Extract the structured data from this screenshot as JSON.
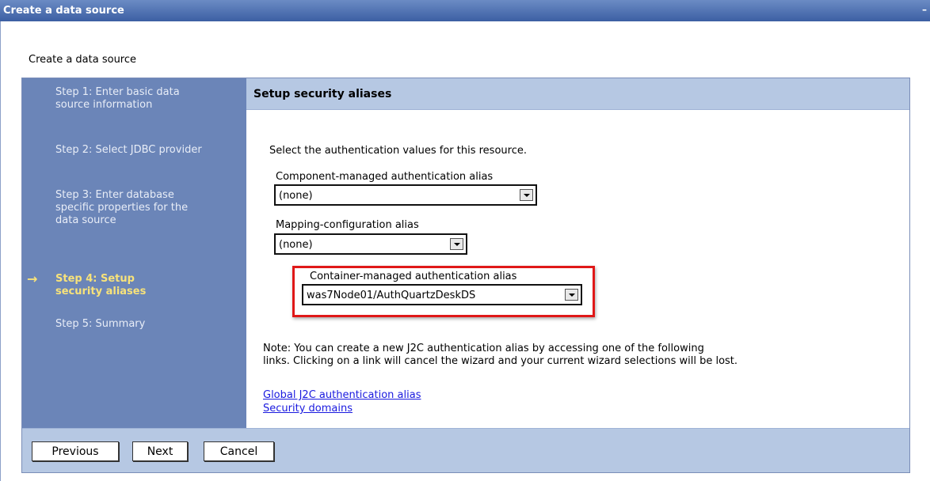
{
  "window": {
    "title": "Create a data source",
    "minimize_glyph": "–"
  },
  "page": {
    "heading": "Create a data source"
  },
  "steps": {
    "items": [
      {
        "label": "Step 1: Enter basic data source information",
        "current": false
      },
      {
        "label": "Step 2: Select JDBC provider",
        "current": false
      },
      {
        "label": "Step 3: Enter database specific properties for the data source",
        "current": false
      },
      {
        "label": "Step 4: Setup security aliases",
        "current": true
      },
      {
        "label": "Step 5: Summary",
        "current": false
      }
    ],
    "current_marker": "→"
  },
  "panel": {
    "title": "Setup security aliases",
    "intro": "Select the authentication values for this resource.",
    "component_alias": {
      "label": "Component-managed authentication alias",
      "value": "(none)"
    },
    "mapping_alias": {
      "label": "Mapping-configuration alias",
      "value": "(none)"
    },
    "container_alias": {
      "label": "Container-managed authentication alias",
      "value": "was7Node01/AuthQuartzDeskDS"
    },
    "note_line1": "Note: You can create a new J2C authentication alias by accessing one of the following",
    "note_line2": "links. Clicking on a link will cancel the wizard and your current wizard selections will be lost.",
    "links": {
      "global_j2c": "Global J2C authentication alias",
      "security_domains": "Security domains"
    }
  },
  "buttons": {
    "previous": "Previous",
    "next": "Next",
    "cancel": "Cancel"
  },
  "colors": {
    "titlebar": "#3c5fa3",
    "step_panel": "#6b85b8",
    "current_step": "#f7e27a",
    "header_band": "#b6c8e3",
    "highlight": "#e01818",
    "link": "#1a1adf"
  }
}
